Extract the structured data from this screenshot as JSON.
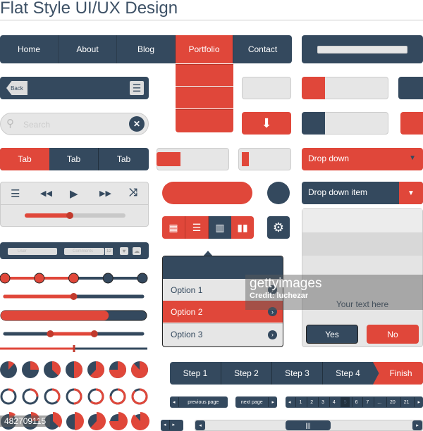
{
  "title": "Flat Style UI/UX Design",
  "colors": {
    "navy": "#34495e",
    "red": "#e0473a",
    "light": "#e6e6e6"
  },
  "nav": {
    "items": [
      "Home",
      "About",
      "Blog",
      "Portfolio",
      "Contact"
    ],
    "active": "Portfolio"
  },
  "back_bar": {
    "back": "Back",
    "menu_icon": "hamburger-icon"
  },
  "search": {
    "placeholder": "Search",
    "clear_icon": "close-icon"
  },
  "tabs": [
    "Tab",
    "Tab",
    "Tab"
  ],
  "player": {
    "icons": [
      "list-icon",
      "rewind-icon",
      "play-icon",
      "fast-forward-icon",
      "shuffle-icon"
    ],
    "progress": 0.45
  },
  "comment_bar": {
    "user_placeholder": "User",
    "comments_placeholder": "Comments",
    "count": "12"
  },
  "sliders": {
    "steps_total": 5,
    "steps_done": 3,
    "slider": 0.5,
    "progress": 0.74,
    "range": [
      0.33,
      0.65
    ],
    "thin": 0.5
  },
  "pie_fractions": [
    0.12,
    0.25,
    0.37,
    0.5,
    0.62,
    0.75,
    0.88
  ],
  "menu": {
    "options": [
      "Option 1",
      "Option 2",
      "Option 3"
    ],
    "selected": "Option 2"
  },
  "dropdowns": {
    "dropdown": "Drop down",
    "dropdown_item": "Drop down item"
  },
  "dialog": {
    "text": "Your text here",
    "yes": "Yes",
    "no": "No"
  },
  "steps": [
    "Step 1",
    "Step 2",
    "Step 3",
    "Step 4",
    "Finish"
  ],
  "pagination": {
    "previous": "previous page",
    "next": "next page",
    "pages": [
      "1",
      "2",
      "3",
      "4",
      "5",
      "6",
      "7",
      "...",
      "20",
      "21"
    ],
    "current": "5"
  },
  "watermark": {
    "brand": "gettyimages",
    "credit": "Credit: luchezar",
    "id": "482709115"
  }
}
